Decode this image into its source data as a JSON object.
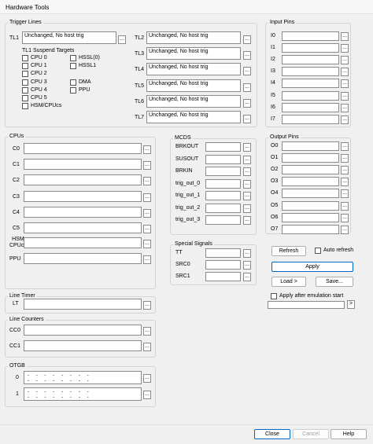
{
  "window": {
    "title": "Hardware Tools"
  },
  "trigger_lines": {
    "legend": "Trigger Lines",
    "tl1_label": "TL1",
    "tl1_value": "Unchanged, No host trig",
    "suspend_title": "TL1 Suspend Targets",
    "suspend_col1": [
      "CPU 0",
      "CPU 1",
      "CPU 2",
      "CPU 3",
      "CPU 4",
      "CPU 5",
      "HSM/CPUcs"
    ],
    "suspend_col2": [
      "HSSL(0)",
      "HSSL1",
      "DMA",
      "PPU"
    ],
    "lines": [
      {
        "label": "TL2",
        "value": "Unchanged, No host trig"
      },
      {
        "label": "TL3",
        "value": "Unchanged, No host trig"
      },
      {
        "label": "TL4",
        "value": "Unchanged, No host trig"
      },
      {
        "label": "TL5",
        "value": "Unchanged, No host trig"
      },
      {
        "label": "TL6",
        "value": "Unchanged, No host trig"
      },
      {
        "label": "TL7",
        "value": "Unchanged, No host trig"
      }
    ]
  },
  "input_pins": {
    "legend": "Input Pins",
    "labels": [
      "I0",
      "I1",
      "I2",
      "I3",
      "I4",
      "I5",
      "I6",
      "I7"
    ]
  },
  "cpus": {
    "legend": "CPUs",
    "labels": [
      "C0",
      "C1",
      "C2",
      "C3",
      "C4",
      "C5"
    ],
    "hsm_label": "HSM\nCPUcs",
    "ppu_label": "PPU"
  },
  "mcds": {
    "legend": "MCDS",
    "labels": [
      "BRKOUT",
      "SUSOUT",
      "BRKIN",
      "trig_out_0",
      "trig_out_1",
      "trig_out_2",
      "trig_out_3"
    ]
  },
  "output_pins": {
    "legend": "Output Pins",
    "labels": [
      "O0",
      "O1",
      "O2",
      "O3",
      "O4",
      "O5",
      "O6",
      "O7"
    ]
  },
  "special_signals": {
    "legend": "Special Signals",
    "labels": [
      "TT",
      "SRC0",
      "SRC1"
    ]
  },
  "controls": {
    "refresh": "Refresh",
    "auto_refresh": "Auto refresh",
    "apply": "Apply",
    "load": "Load >",
    "save": "Save...",
    "apply_after": "Apply after emulation start",
    "arrow": ">"
  },
  "line_timer": {
    "legend": "Line Timer",
    "label": "LT"
  },
  "line_counters": {
    "legend": "Line Counters",
    "labels": [
      "CC0",
      "CC1"
    ]
  },
  "otgb": {
    "legend": "OTGB",
    "labels": [
      "0",
      "1"
    ],
    "pattern": "-  -  -  -  -  -  -  -\n-  -  -  -  -  -  -  -"
  },
  "footer": {
    "close": "Close",
    "cancel": "Cancel",
    "help": "Help"
  },
  "ellipsis": "..."
}
